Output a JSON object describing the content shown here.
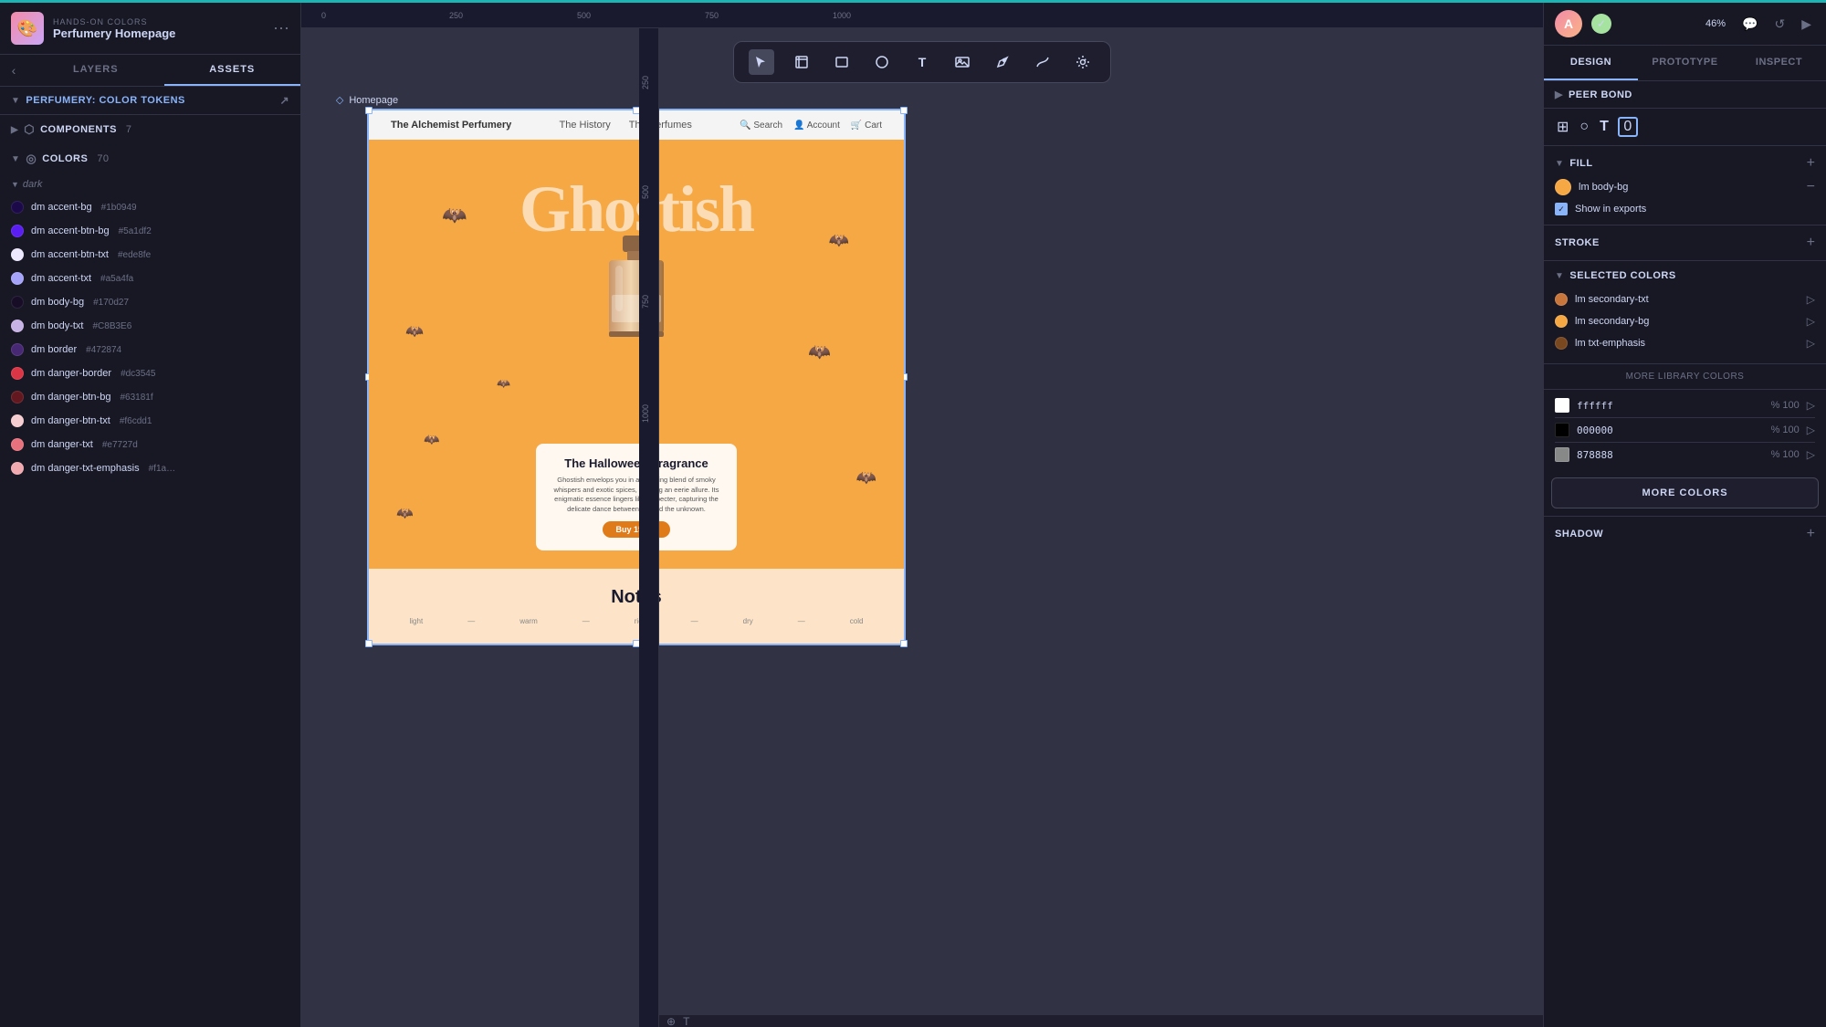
{
  "app": {
    "subtitle": "HANDS-ON COLORS",
    "title": "Perfumery Homepage",
    "logo_emoji": "🎨"
  },
  "left_nav": {
    "back_arrow": "‹",
    "tab_layers": "LAYERS",
    "tab_assets": "ASSETS"
  },
  "asset_section": {
    "title": "PERFUMERY: COLOR TOKENS",
    "export_icon": "↗"
  },
  "components": {
    "label": "COMPONENTS",
    "count": "7"
  },
  "colors": {
    "label": "COLORS",
    "count": "70"
  },
  "groups": [
    {
      "name": "dark",
      "items": [
        {
          "name": "dm accent-bg",
          "hex": "#1b0949",
          "color": "#1b0949"
        },
        {
          "name": "dm accent-btn-bg",
          "hex": "#5a1df2",
          "color": "#5a1df2"
        },
        {
          "name": "dm accent-btn-txt",
          "hex": "#ede8fe",
          "color": "#ede8fe"
        },
        {
          "name": "dm accent-txt",
          "hex": "#a5a4fa",
          "color": "#a5a4fa"
        },
        {
          "name": "dm body-bg",
          "hex": "#170d27",
          "color": "#170d27"
        },
        {
          "name": "dm body-txt",
          "hex": "#C8B3E6",
          "color": "#C8B3E6"
        },
        {
          "name": "dm border",
          "hex": "#472874",
          "color": "#472874"
        },
        {
          "name": "dm danger-border",
          "hex": "#dc3545",
          "color": "#dc3545"
        },
        {
          "name": "dm danger-btn-bg",
          "hex": "#63181f",
          "color": "#63181f"
        },
        {
          "name": "dm danger-btn-txt",
          "hex": "#f6cdd1",
          "color": "#f6cdd1"
        },
        {
          "name": "dm danger-txt",
          "hex": "#e7727d",
          "color": "#e7727d"
        },
        {
          "name": "dm danger-txt-emphasis",
          "hex": "#f1a",
          "color": "#f1aab0"
        }
      ]
    }
  ],
  "toolbar": {
    "tools": [
      "cursor",
      "frame",
      "rectangle",
      "circle",
      "text",
      "image",
      "pen",
      "path",
      "settings"
    ]
  },
  "canvas": {
    "frame_label": "Homepage",
    "frame_icon": "◇",
    "ruler_marks": [
      "0",
      "250",
      "500",
      "750",
      "1000"
    ],
    "ruler_v_marks": [
      "250",
      "500",
      "750",
      "1000"
    ]
  },
  "design_content": {
    "nav": {
      "logo": "The Alchemist Perfumery",
      "links": [
        "The History",
        "The Perfumes"
      ],
      "actions": [
        "Search",
        "Account",
        "Cart"
      ]
    },
    "hero_text": "Ghostish",
    "product": {
      "title": "The Halloween Fragrance",
      "description": "Ghostish envelops you in a haunting blend of smoky whispers and exotic spices, evoking an eerie allure. Its enigmatic essence lingers like a specter, capturing the delicate dance between life and the unknown.",
      "button": "Buy 150ml"
    },
    "notes_title": "Notes"
  },
  "right_panel": {
    "tabs": [
      "DESIGN",
      "PROTOTYPE",
      "INSPECT"
    ],
    "active_tab": "DESIGN",
    "user_initial": "A",
    "zoom": "46%",
    "peer_border_title": "PEER BOND"
  },
  "fill_section": {
    "title": "FILL",
    "color_name": "lm body-bg",
    "color_swatch": "#f5a844",
    "show_in_exports": "Show in exports",
    "show_in_exports_checked": true
  },
  "stroke_section": {
    "title": "STROKE"
  },
  "selected_colors": {
    "title": "SELECTED COLORS",
    "items": [
      {
        "name": "lm secondary-txt",
        "color": "#c8763c"
      },
      {
        "name": "lm secondary-bg",
        "color": "#f5a844"
      },
      {
        "name": "lm txt-emphasis",
        "color": "#7a4820"
      }
    ]
  },
  "library_colors": {
    "header": "MORE LIBRARY COLORS",
    "items": [
      {
        "hex": "ffffff",
        "color": "#ffffff",
        "opacity": "100"
      },
      {
        "hex": "000000",
        "color": "#000000",
        "opacity": "100"
      },
      {
        "hex": "878888",
        "color": "#878888",
        "opacity": "100"
      }
    ]
  },
  "more_colors_btn": "MORE COLORS",
  "shadow_section": {
    "title": "SHADOW"
  }
}
